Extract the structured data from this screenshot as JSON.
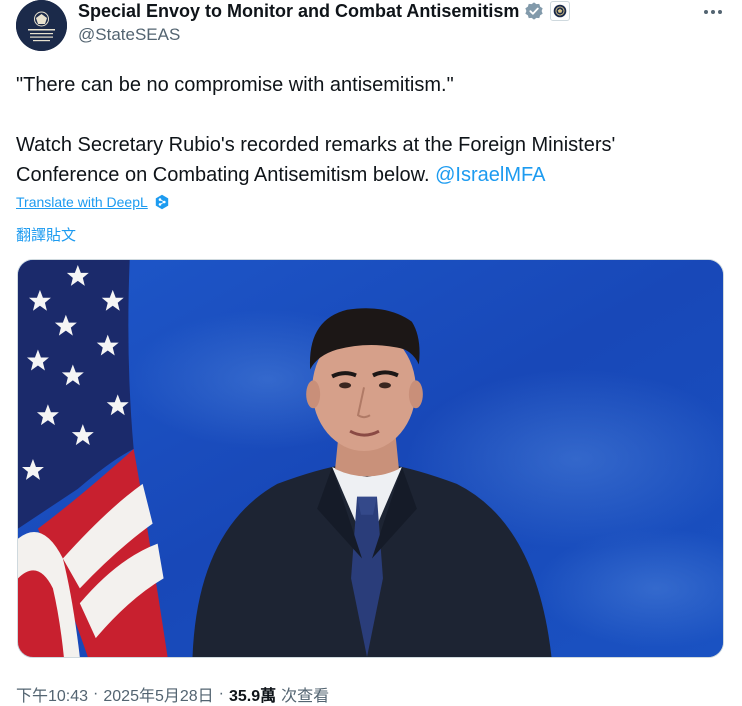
{
  "author": {
    "display_name": "Special Envoy to Monitor and Combat Antisemitism",
    "handle": "@StateSEAS",
    "avatar_icon": "state-department-seal-icon",
    "verified_icon": "verified-badge-icon",
    "affiliation_icon": "state-department-affiliation-icon"
  },
  "more_icon": "more-options-icon",
  "tweet": {
    "line1": "\"There can be no compromise with antisemitism.\"",
    "line2": "Watch Secretary Rubio's recorded remarks at the Foreign Ministers' Conference on Combating Antisemitism below.",
    "mention": "@IsraelMFA"
  },
  "translate": {
    "deepl_label": "Translate with DeepL",
    "deepl_icon": "deepl-icon",
    "post_label": "翻譯貼文"
  },
  "media": {
    "type": "video-thumbnail",
    "icon": "video-still-image"
  },
  "meta": {
    "time": "下午10:43",
    "sep1": "·",
    "date": "2025年5月28日",
    "sep2": "·",
    "views_count": "35.9萬",
    "views_label": "次查看"
  },
  "colors": {
    "accent": "#1d9bf0",
    "text": "#0f1419",
    "secondary": "#536471",
    "verified": "#829aab",
    "media_bg": "#1747b5"
  }
}
